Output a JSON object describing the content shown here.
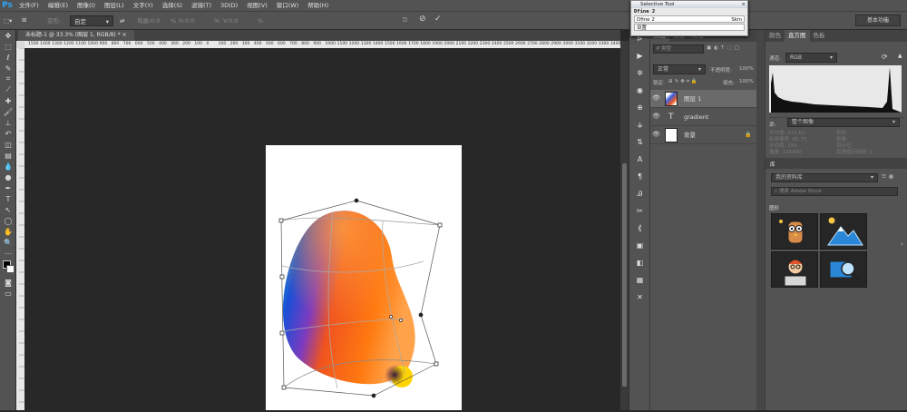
{
  "app": {
    "logo": "Ps"
  },
  "menu": [
    "文件(F)",
    "编辑(E)",
    "图像(I)",
    "图层(L)",
    "文字(Y)",
    "选择(S)",
    "滤镜(T)",
    "3D(D)",
    "视图(V)",
    "窗口(W)",
    "帮助(H)"
  ],
  "options": {
    "transform_label": "变形:",
    "transform_mode": "自定",
    "bend_label": "弯曲:",
    "bend_value": "0.0",
    "bend_unit": "%",
    "h_label": "H:",
    "h_value": "0.0",
    "h_unit": "%",
    "v_label": "V:",
    "v_value": "0.0",
    "v_unit": "%",
    "workspace": "基本功能"
  },
  "document": {
    "tab_title": "未标题-1 @ 33.3% (图层 1, RGB/8) *"
  },
  "ruler_ticks": [
    "1500",
    "1400",
    "1300",
    "1200",
    "1100",
    "1000",
    "900",
    "800",
    "700",
    "600",
    "500",
    "400",
    "300",
    "200",
    "100",
    "0",
    "100",
    "200",
    "300",
    "400",
    "500",
    "600",
    "700",
    "800",
    "900",
    "1000",
    "1100",
    "1200",
    "1300",
    "1400",
    "1500",
    "1600",
    "1700",
    "1800",
    "1900",
    "2000",
    "2100",
    "2200",
    "2300",
    "2400",
    "2500",
    "2600",
    "2700",
    "2800",
    "2900",
    "3000",
    "3100",
    "3200",
    "3300",
    "3400"
  ],
  "selective_tool": {
    "title": "Selective Tool",
    "heading": "Dfine 2",
    "row1_left": "Dfine 2",
    "row1_right": "Skin",
    "row2": "设置"
  },
  "layers_panel": {
    "tabs": [
      "图层",
      "通道",
      "路径"
    ],
    "search_placeholder": "P 类型",
    "blend_mode": "正常",
    "opacity_label": "不透明度:",
    "opacity_value": "100%",
    "lock_label": "锁定:",
    "fill_label": "填充:",
    "fill_value": "100%",
    "layers": [
      {
        "name": "图层 1",
        "type": "image"
      },
      {
        "name": "gradient",
        "type": "text",
        "glyph": "T"
      },
      {
        "name": "背景",
        "type": "background"
      }
    ]
  },
  "histogram_panel": {
    "tabs": [
      "颜色",
      "直方图",
      "色板"
    ],
    "channel_label": "通道:",
    "channel_value": "RGB",
    "source_label": "源:",
    "source_value": "整个图像",
    "stats_left": [
      {
        "label": "平均值:",
        "value": "211.62"
      },
      {
        "label": "标准偏差:",
        "value": "65.75"
      },
      {
        "label": "中间值:",
        "value": "255"
      },
      {
        "label": "像素:",
        "value": "138490"
      }
    ],
    "stats_right": [
      {
        "label": "色阶:",
        "value": ""
      },
      {
        "label": "数量:",
        "value": ""
      },
      {
        "label": "百分位:",
        "value": ""
      },
      {
        "label": "高速缓存级别:",
        "value": "1"
      }
    ]
  },
  "library_panel": {
    "title": "库",
    "library_name": "我的资料库",
    "search_placeholder": "搜索 Adobe Stock",
    "section": "图形"
  },
  "colors": {
    "accent": "#2fa3f5",
    "panel": "#535353",
    "canvas": "#282828"
  }
}
